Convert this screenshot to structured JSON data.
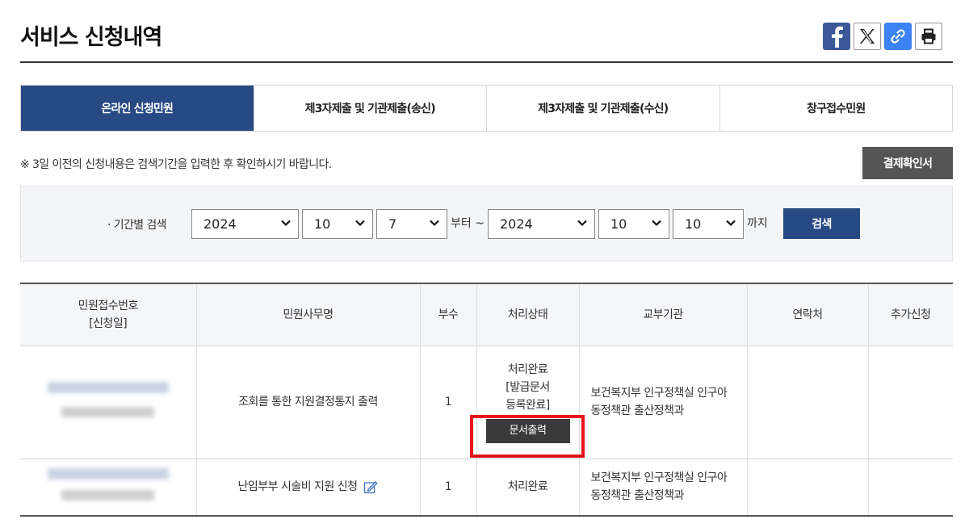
{
  "page": {
    "title": "서비스 신청내역"
  },
  "share_icons": [
    "facebook-icon",
    "x-icon",
    "link-icon",
    "printer-icon"
  ],
  "tabs": [
    {
      "label": "온라인 신청민원",
      "active": true
    },
    {
      "label": "제3자제출 및 기관제출(송신)",
      "active": false
    },
    {
      "label": "제3자제출 및 기관제출(수신)",
      "active": false
    },
    {
      "label": "창구접수민원",
      "active": false
    }
  ],
  "notice": "※ 3일 이전의 신청내용은 검색기간을 입력한 후 확인하시기 바랍니다.",
  "receipt_button": "결제확인서",
  "search": {
    "label": "· 기간별 검색",
    "from_year": "2024",
    "from_month": "10",
    "from_day": "7",
    "from_suffix": "부터 ~",
    "to_year": "2024",
    "to_month": "10",
    "to_day": "10",
    "to_suffix": "까지",
    "button": "검색"
  },
  "table": {
    "headers": {
      "receipt_no": "민원접수번호",
      "receipt_date": "[신청일]",
      "name": "민원사무명",
      "copies": "부수",
      "status": "처리상태",
      "agency": "교부기관",
      "contact": "연락처",
      "extra": "추가신청"
    },
    "rows": [
      {
        "name": "조회를 통한 지원결정통지 출력",
        "copies": "1",
        "status_1": "처리완료",
        "status_2": "[발급문서",
        "status_3": "등록완료]",
        "action": "문서출력",
        "agency_1": "보건복지부 인구정책실 인구아",
        "agency_2": "동정책관 출산정책과"
      },
      {
        "name": "난임부부 시술비 지원 신청",
        "copies": "1",
        "status_1": "처리완료",
        "agency_1": "보건복지부 인구정책실 인구아",
        "agency_2": "동정책관 출산정책과"
      }
    ]
  },
  "colors": {
    "primary": "#284a84",
    "highlight": "#e8141b",
    "facebook": "#3b5998",
    "link": "#3d83f5"
  }
}
